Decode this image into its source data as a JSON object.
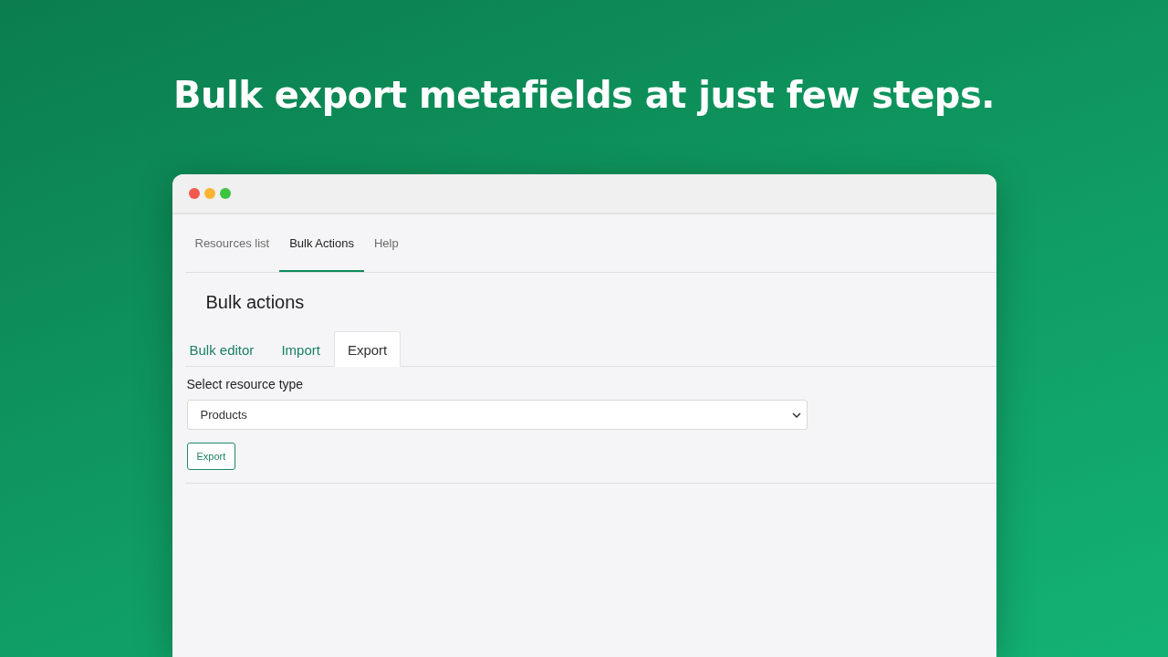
{
  "headline": "Bulk export metafields at just few steps.",
  "nav_tabs": [
    {
      "label": "Resources list",
      "selected": false
    },
    {
      "label": "Bulk Actions",
      "selected": true
    },
    {
      "label": "Help",
      "selected": false
    }
  ],
  "page_title": "Bulk actions",
  "sub_tabs": [
    {
      "label": "Bulk editor",
      "selected": false
    },
    {
      "label": "Import",
      "selected": false
    },
    {
      "label": "Export",
      "selected": true
    }
  ],
  "form": {
    "label": "Select resource type",
    "select_value": "Products",
    "button": "Export"
  }
}
